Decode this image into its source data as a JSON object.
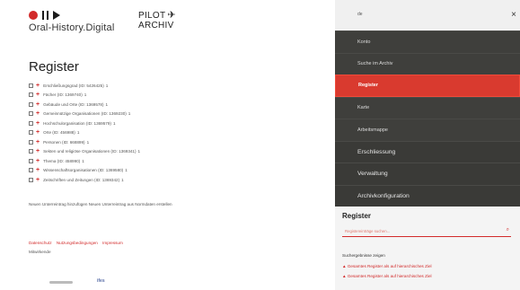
{
  "brand": {
    "name": "Oral-History.Digital",
    "pilot_line1": "PILOT",
    "pilot_line2": "ARCHIV",
    "plane_icon": "airplane-icon",
    "logo_color": "#d22a2a"
  },
  "main": {
    "title": "Register",
    "registers": [
      {
        "label": "Erschließungsgrad (ID: 5426425)",
        "count": "1"
      },
      {
        "label": "Fächer (ID: 1369740)",
        "count": "1"
      },
      {
        "label": "Gebäude und Orte (ID: 1369578)",
        "count": "1"
      },
      {
        "label": "Gemeinnützige Organisationen (ID: 1369230)",
        "count": "1"
      },
      {
        "label": "Hochschulorganisation (ID: 1369579)",
        "count": "1"
      },
      {
        "label": "Orte (ID: 456988)",
        "count": "1"
      },
      {
        "label": "Personen (ID: 668899)",
        "count": "1"
      },
      {
        "label": "Sekten und religiöse Organisationen (ID: 1369341)",
        "count": "1"
      },
      {
        "label": "Thema (ID: 458990)",
        "count": "1"
      },
      {
        "label": "Wissenschaftsorganisationen (ID: 1369580)",
        "count": "1"
      },
      {
        "label": "Zeitschriften und Zeitungen (ID: 1369342)",
        "count": "1"
      }
    ],
    "new_entry_text": "Neuen Unterreintrag hinzufügen  Neuen Unterreintrag aus Normdaten erstellen"
  },
  "footer": {
    "links": [
      "Datenschutz",
      "Nutzungsbedingungen",
      "Impressum"
    ],
    "language": "Mitwirkende",
    "partner_logo": "ifes"
  },
  "sidebar": {
    "language_selector": "de",
    "close_icon": "close-icon",
    "nav_small": [
      "Konto",
      "Suche im Archiv",
      "Register",
      "Karte",
      "Arbeitsmappe"
    ],
    "active_item": "Register",
    "nav_big": [
      "Erschliessung",
      "Verwaltung",
      "Archivkonfiguration"
    ],
    "accent_color": "#d93a2f",
    "panel": {
      "title": "Register",
      "search_placeholder": "Registereinträge suchen...",
      "show_term_label": "Suchergebnisse zeigen",
      "expand_all": "Gesamtes Register als auf hierarchisches Ziel",
      "collapse_all": "Gesamtes Register als auf hierarchisches Ziel"
    }
  }
}
